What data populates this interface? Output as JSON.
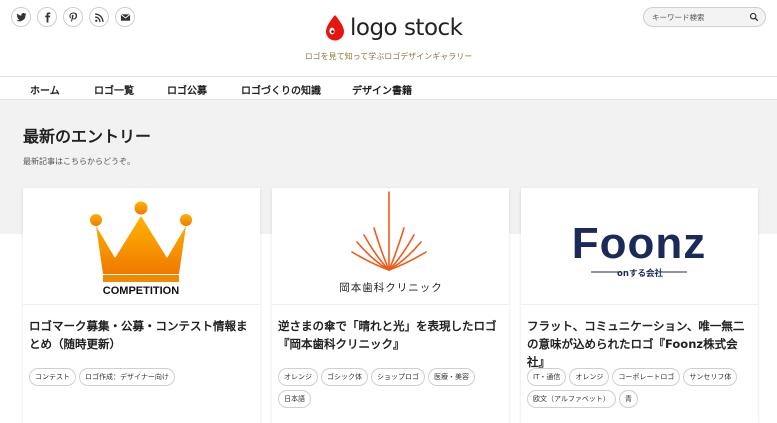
{
  "header": {
    "logo_text": "logo stock",
    "tagline": "ロゴを見て知って学ぶロゴデザインギャラリー",
    "search_placeholder": "キーワード検索",
    "social": [
      "twitter-icon",
      "facebook-icon",
      "pinterest-icon",
      "rss-icon",
      "mail-icon"
    ],
    "brand_color": "#e8140f"
  },
  "nav": {
    "items": [
      {
        "label": "ホーム"
      },
      {
        "label": "ロゴ一覧"
      },
      {
        "label": "ロゴ公募"
      },
      {
        "label": "ロゴづくりの知識"
      },
      {
        "label": "デザイン書籍"
      }
    ]
  },
  "main": {
    "heading": "最新のエントリー",
    "subheading": "最新記事はこちらからどうぞ。"
  },
  "cards": [
    {
      "thumb_text": "COMPETITION",
      "title": "ロゴマーク募集・公募・コンテスト情報まとめ（随時更新）",
      "tags": [
        "コンテスト",
        "ロゴ作成：デザイナー向け"
      ]
    },
    {
      "thumb_text": "岡本歯科クリニック",
      "title": "逆さまの傘で「晴れと光」を表現したロゴ『岡本歯科クリニック』",
      "tags": [
        "オレンジ",
        "ゴシック体",
        "ショップロゴ",
        "医療・美容",
        "日本語"
      ]
    },
    {
      "thumb_text": "Foonz",
      "thumb_subtext": "onする会社",
      "title": "フラット、コミュニケーション、唯一無二の意味が込められたロゴ『Foonz株式会社』",
      "tags": [
        "IT・通信",
        "オレンジ",
        "コーポレートロゴ",
        "サンセリフ体",
        "欧文（アルファベット）",
        "青"
      ]
    }
  ]
}
